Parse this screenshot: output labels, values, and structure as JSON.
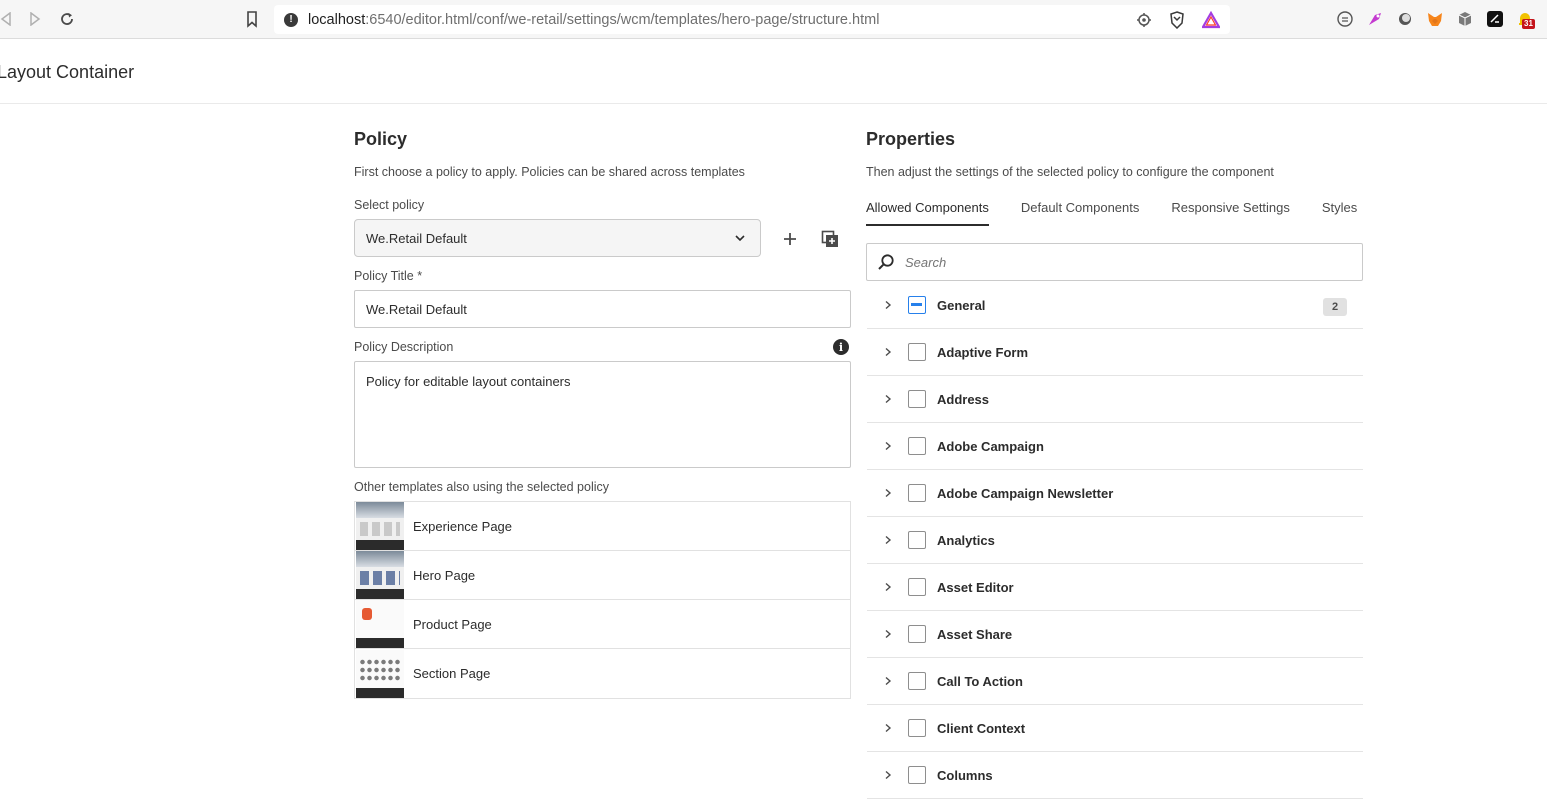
{
  "browser": {
    "url_host": "localhost",
    "url_rest": ":6540/editor.html/conf/we-retail/settings/wcm/templates/hero-page/structure.html",
    "notification_count": "31"
  },
  "header": {
    "title": "Layout Container"
  },
  "policy": {
    "title": "Policy",
    "description": "First choose a policy to apply. Policies can be shared across templates",
    "select_label": "Select policy",
    "select_value": "We.Retail Default",
    "policy_title_label": "Policy Title *",
    "policy_title_value": "We.Retail Default",
    "policy_description_label": "Policy Description",
    "policy_description_value": "Policy for editable layout containers",
    "other_templates_label": "Other templates also using the selected policy",
    "templates": [
      {
        "name": "Experience Page",
        "thumb": "experience"
      },
      {
        "name": "Hero Page",
        "thumb": "hero"
      },
      {
        "name": "Product Page",
        "thumb": "product"
      },
      {
        "name": "Section Page",
        "thumb": "section"
      }
    ]
  },
  "properties": {
    "title": "Properties",
    "description": "Then adjust the settings of the selected policy to configure the component",
    "tabs": [
      {
        "label": "Allowed Components",
        "active": true
      },
      {
        "label": "Default Components",
        "active": false
      },
      {
        "label": "Responsive Settings",
        "active": false
      },
      {
        "label": "Styles",
        "active": false
      }
    ],
    "search_placeholder": "Search",
    "components": [
      {
        "label": "General",
        "state": "indeterminate",
        "badge": "2"
      },
      {
        "label": "Adaptive Form",
        "state": "unchecked",
        "badge": ""
      },
      {
        "label": "Address",
        "state": "unchecked",
        "badge": ""
      },
      {
        "label": "Adobe Campaign",
        "state": "unchecked",
        "badge": ""
      },
      {
        "label": "Adobe Campaign Newsletter",
        "state": "unchecked",
        "badge": ""
      },
      {
        "label": "Analytics",
        "state": "unchecked",
        "badge": ""
      },
      {
        "label": "Asset Editor",
        "state": "unchecked",
        "badge": ""
      },
      {
        "label": "Asset Share",
        "state": "unchecked",
        "badge": ""
      },
      {
        "label": "Call To Action",
        "state": "unchecked",
        "badge": ""
      },
      {
        "label": "Client Context",
        "state": "unchecked",
        "badge": ""
      },
      {
        "label": "Columns",
        "state": "unchecked",
        "badge": ""
      }
    ]
  },
  "colors": {
    "accent": "#2680eb",
    "text": "#2c2c2c"
  }
}
